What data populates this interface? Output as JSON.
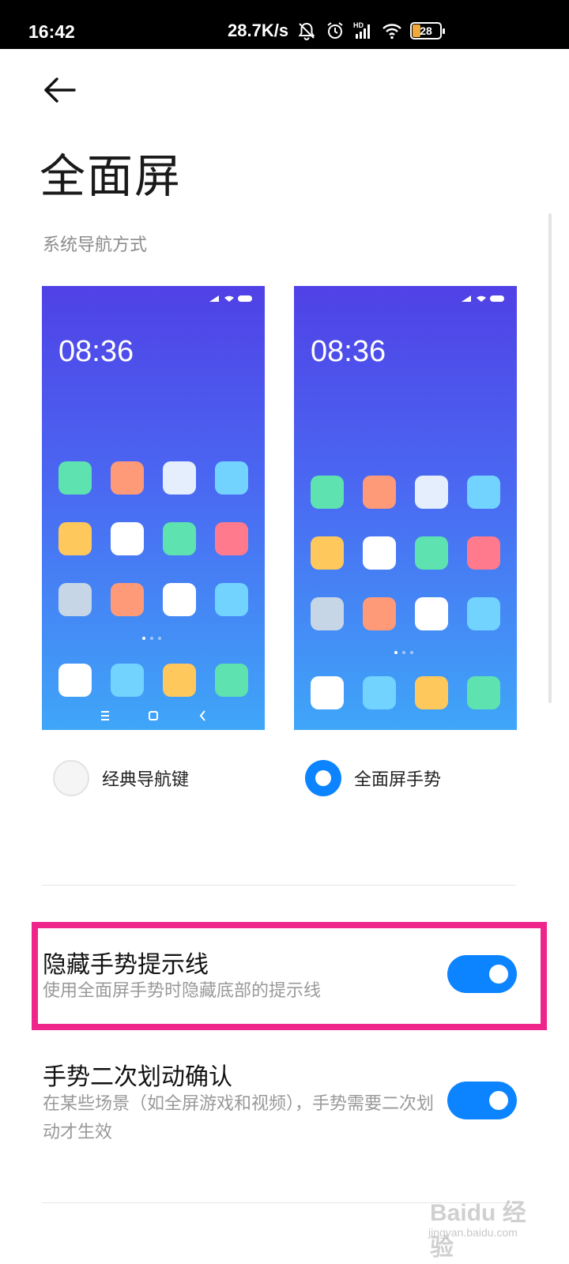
{
  "status_bar": {
    "time": "16:42",
    "speed": "28.7K/s",
    "network_label": "HD",
    "battery": "28",
    "battery_level": 0.28,
    "icons": [
      "bell-off-icon",
      "alarm-icon",
      "signal-icon",
      "wifi-icon",
      "battery-icon"
    ]
  },
  "header": {
    "back_icon": "back-arrow-icon",
    "title": "全面屏"
  },
  "navigation": {
    "section_label": "系统导航方式",
    "preview_time": "08:36",
    "app_colors": [
      "#5ee2b0",
      "#ff9a78",
      "#e4eefc",
      "#73d3ff",
      "#ffc85c",
      "#ffffff",
      "#5ee2b0",
      "#ff7a8c",
      "#c6d6e6",
      "#ff9a78",
      "#ffffff",
      "#73d3ff",
      "#ffffff",
      "#73d3ff",
      "#ffc85c",
      "#5ee2b0"
    ],
    "options": [
      {
        "label": "经典导航键",
        "selected": false
      },
      {
        "label": "全面屏手势",
        "selected": true
      }
    ]
  },
  "settings": [
    {
      "title": "隐藏手势提示线",
      "description": "使用全面屏手势时隐藏底部的提示线",
      "enabled": true
    },
    {
      "title": "手势二次划动确认",
      "description": "在某些场景（如全屏游戏和视频），手势需要二次划动才生效",
      "enabled": true
    }
  ],
  "watermark": {
    "brand": "Bai",
    "brand2": "经验",
    "url": "jingyan.baidu.com"
  },
  "colors": {
    "accent": "#0d84ff",
    "highlight": "#f0258c"
  }
}
